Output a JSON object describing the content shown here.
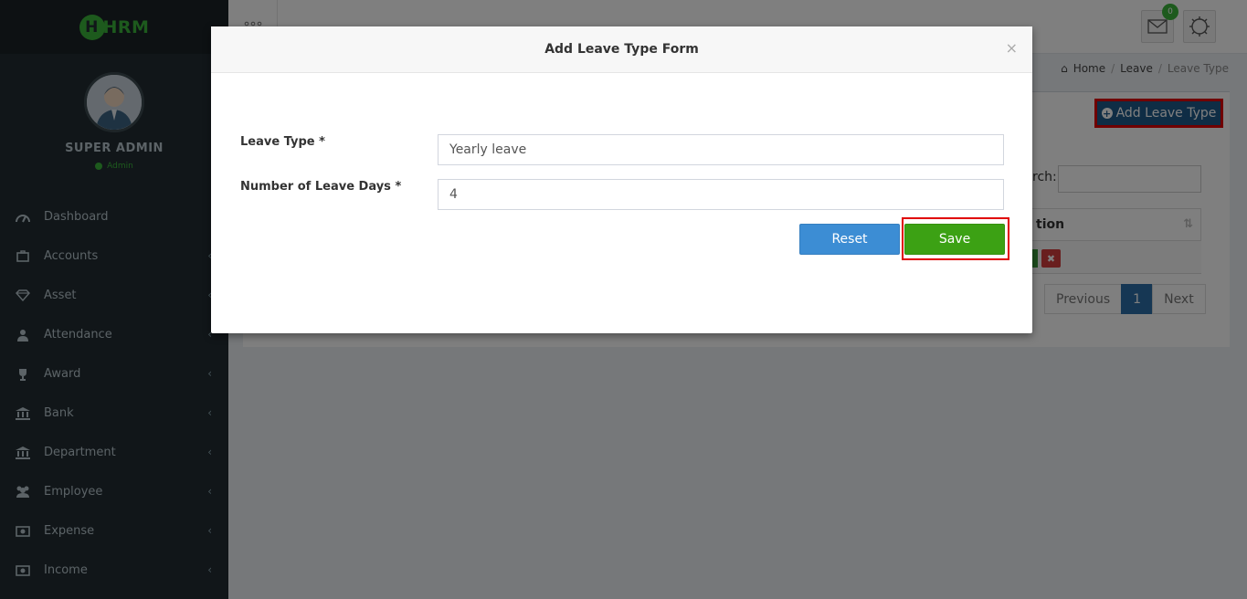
{
  "app": {
    "logo_letter": "H",
    "logo_text": "HRM"
  },
  "user": {
    "name": "SUPER ADMIN",
    "role": "Admin"
  },
  "sidebar": {
    "items": [
      {
        "label": "Dashboard",
        "icon": "dashboard-icon",
        "has_chevron": false
      },
      {
        "label": "Accounts",
        "icon": "briefcase-icon",
        "has_chevron": true
      },
      {
        "label": "Asset",
        "icon": "diamond-icon",
        "has_chevron": true
      },
      {
        "label": "Attendance",
        "icon": "user-icon",
        "has_chevron": true
      },
      {
        "label": "Award",
        "icon": "trophy-icon",
        "has_chevron": true
      },
      {
        "label": "Bank",
        "icon": "bank-icon",
        "has_chevron": true
      },
      {
        "label": "Department",
        "icon": "bank-icon",
        "has_chevron": true
      },
      {
        "label": "Employee",
        "icon": "users-icon",
        "has_chevron": true
      },
      {
        "label": "Expense",
        "icon": "money-icon",
        "has_chevron": true
      },
      {
        "label": "Income",
        "icon": "money-icon",
        "has_chevron": true
      }
    ]
  },
  "header": {
    "mail_count": "0"
  },
  "breadcrumb": {
    "home": "Home",
    "section": "Leave",
    "current": "Leave Type"
  },
  "page": {
    "add_button": "Add Leave Type",
    "search_label": "rch:",
    "table_header_action": "tion",
    "pagination": {
      "previous": "Previous",
      "current": "1",
      "next": "Next"
    }
  },
  "modal": {
    "title": "Add Leave Type Form",
    "close": "×",
    "fields": {
      "leave_type_label": "Leave Type *",
      "leave_type_value": "Yearly leave",
      "days_label": "Number of Leave Days *",
      "days_value": "4"
    },
    "reset_label": "Reset",
    "save_label": "Save"
  },
  "colors": {
    "sidebar": "#222d32",
    "accent": "#3bb53b",
    "primary": "#3c8dd4",
    "save": "#3ca114",
    "highlight": "#e00000"
  }
}
